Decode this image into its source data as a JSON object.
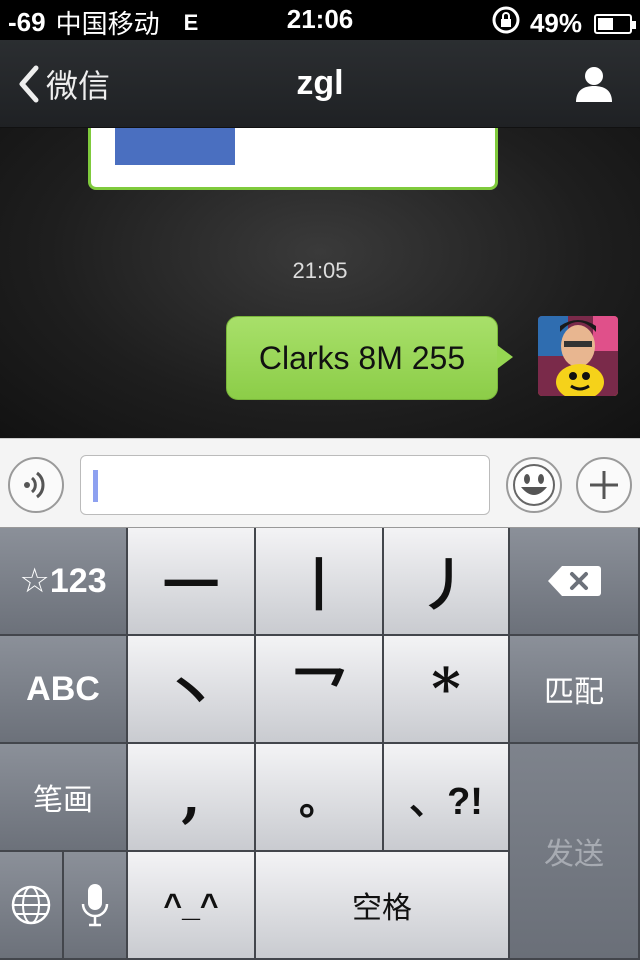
{
  "status_bar": {
    "signal": "-69",
    "carrier": "中国移动",
    "network": "E",
    "time": "21:06",
    "battery": "49%",
    "battery_level": 0.49
  },
  "nav": {
    "back_label": "微信",
    "title": "zgl"
  },
  "chat": {
    "timestamp": "21:05",
    "messages": [
      {
        "text": "Clarks 8M 255",
        "outgoing": true
      }
    ]
  },
  "keyboard": {
    "row1": {
      "mode": "☆123",
      "k1": "一",
      "k2": "丨",
      "k3": "丿"
    },
    "row2": {
      "mode": "ABC",
      "k1": "丶",
      "k2": "乛",
      "k3": "*",
      "action": "匹配"
    },
    "row3": {
      "mode": "笔画",
      "k1": ",",
      "k2": "。",
      "k3": "、?!"
    },
    "row4": {
      "k1": "^_^",
      "space": "空格"
    },
    "send": "发送"
  },
  "colors": {
    "bubble": "#96d652",
    "card_border": "#7fca3c",
    "caret": "#8ea1f0"
  }
}
